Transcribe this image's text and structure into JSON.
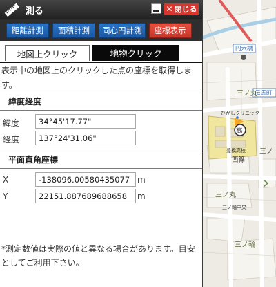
{
  "panel": {
    "title": "測る",
    "close_label": "閉じる",
    "modes": [
      "距離計測",
      "面積計測",
      "同心円計測",
      "座標表示"
    ],
    "active_mode": "座標表示",
    "tabs": [
      "地図上クリック",
      "地物クリック"
    ],
    "description": "表示中の地図上のクリックした点の座標を取得します。",
    "latlon": {
      "heading": "緯度経度",
      "lat_label": "緯度",
      "lat_value": "34°45'17.77\"",
      "lon_label": "経度",
      "lon_value": "137°24'31.06\""
    },
    "plane": {
      "heading": "平面直角座標",
      "x_label": "X",
      "x_value": "-138096.00580435077",
      "y_label": "Y",
      "y_value": "22151.887689688658",
      "unit": "m"
    },
    "note": "*測定数値は実際の値と異なる場合があります。目安としてご利用下さい。"
  },
  "map": {
    "labels": {
      "enrokubashi": "円六橋",
      "denmacho": "伝馬町",
      "sannomaru1": "三ノ丸",
      "sannomaru2": "三ノ",
      "sannomaru3": "三ノ丸",
      "sannomaru4": "三ノ輪",
      "nishi": "西篠",
      "toyohashi": "豊橋高校",
      "school_symbol": "高",
      "clinic": "ひがしクリニック",
      "sannomaru_route": "三ノ輪中央"
    }
  },
  "colors": {
    "mode_blue": "#1a58a3",
    "mode_active": "#c9362a",
    "close_red": "#d8352c",
    "marker_orange": "#f5a623"
  }
}
